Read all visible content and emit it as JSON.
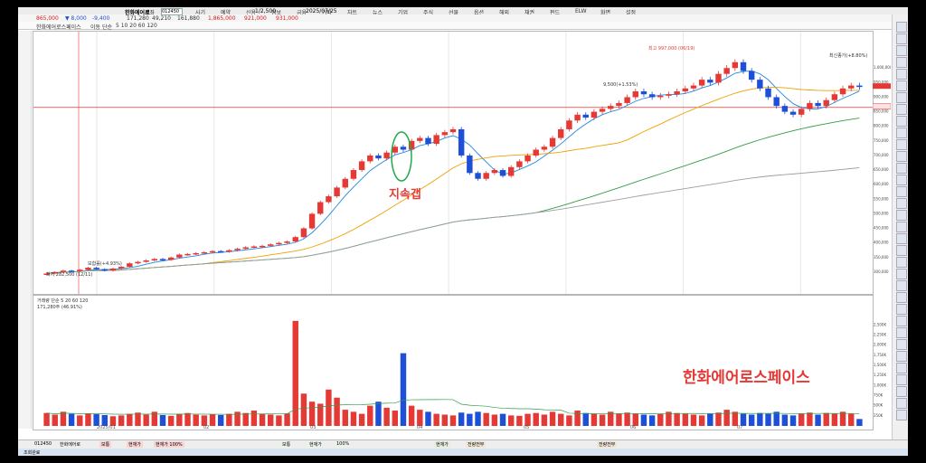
{
  "toolbar": {
    "top_items": [
      "계좌",
      "팔기",
      "사기",
      "예약",
      "신용",
      "정보",
      "금융",
      "기타",
      "차트",
      "뉴스",
      "기업",
      "주식",
      "선물",
      "옵션",
      "해외",
      "채권",
      "펀드",
      "ELW",
      "화면",
      "설정"
    ],
    "stock_code": "012450",
    "stock_name": "한화에어로",
    "row2": {
      "price": "865,000",
      "change": "▼ 8,000",
      "change2": "-9,400",
      "volume_label": "171,280",
      "value": "49,210",
      "info1": "161,880",
      "info2": "1,865,000",
      "info3": "921,000",
      "info4": "931,000",
      "date": "2025/07/25",
      "ratio": "1/2,500"
    },
    "row3": {
      "indicator": "한화에어로스페이스",
      "ma_label": "이동 단순",
      "ma_periods": "5 10 20 60 120"
    }
  },
  "chart_data": [
    {
      "type": "candlestick",
      "title": "",
      "ylabel": "",
      "ylim": [
        250000,
        1100000
      ],
      "x_ticks": [
        "2025/01",
        "02",
        "03",
        "04",
        "05",
        "06",
        "07"
      ],
      "y_ticks": [
        300000,
        350000,
        400000,
        450000,
        500000,
        550000,
        600000,
        650000,
        700000,
        750000,
        800000,
        850000,
        900000,
        950000,
        1000000
      ],
      "y_tick_labels": [
        "300,000",
        "350,000",
        "400,000",
        "450,000",
        "500,000",
        "550,000",
        "600,000",
        "650,000",
        "700,000",
        "750,000",
        "800,000",
        "850,000",
        "900,000",
        "950,000",
        "1,000,000"
      ],
      "horizontal_line": 865000,
      "current_price": 935000,
      "series": [
        {
          "name": "5",
          "color": "#1e88e5"
        },
        {
          "name": "20",
          "color": "#f0a000"
        },
        {
          "name": "60",
          "color": "#2e9e4a"
        },
        {
          "name": "120",
          "color": "#9e9e9e"
        }
      ],
      "close_values": [
        295000,
        300000,
        305000,
        303000,
        308000,
        315000,
        310000,
        305000,
        312000,
        318000,
        330000,
        335000,
        340000,
        345000,
        342000,
        350000,
        360000,
        362000,
        365000,
        368000,
        372000,
        370000,
        375000,
        380000,
        385000,
        388000,
        390000,
        395000,
        400000,
        405000,
        420000,
        450000,
        500000,
        540000,
        560000,
        590000,
        620000,
        650000,
        680000,
        700000,
        690000,
        710000,
        730000,
        720000,
        750000,
        760000,
        740000,
        770000,
        780000,
        790000,
        700000,
        640000,
        620000,
        640000,
        650000,
        630000,
        660000,
        680000,
        700000,
        720000,
        730000,
        760000,
        790000,
        820000,
        840000,
        830000,
        850000,
        860000,
        870000,
        880000,
        900000,
        920000,
        910000,
        900000,
        905000,
        910000,
        920000,
        930000,
        940000,
        960000,
        950000,
        980000,
        1000000,
        1020000,
        990000,
        960000,
        930000,
        900000,
        870000,
        850000,
        840000,
        860000,
        880000,
        870000,
        890000,
        910000,
        930000,
        940000,
        935000
      ],
      "annotations": [
        {
          "text": "최저 282,500 (12/11)"
        },
        {
          "text": "최고 997,000 (06/19)"
        },
        {
          "text": "보합률(+4.93%)"
        },
        {
          "text": "9,500(+1.53%)"
        },
        {
          "text": "최신종가(+8.80%)"
        }
      ],
      "handwritten_label": "지속갭",
      "watermark_title": "한화에어로스페이스"
    },
    {
      "type": "bar",
      "title": "",
      "legend_label": "거래량 단순 5 20 60 120",
      "value_label": "171,280주 (46.91%)",
      "ylim": [
        0,
        3000000
      ],
      "y_ticks": [
        250000,
        500000,
        750000,
        1000000,
        1250000,
        1500000,
        1750000,
        2000000,
        2250000,
        2500000
      ],
      "y_tick_labels": [
        "250K",
        "500K",
        "750K",
        "1,000K",
        "1,250K",
        "1,500K",
        "1,750K",
        "2,000K",
        "2,250K",
        "2,500K"
      ],
      "values": [
        320000,
        280000,
        350000,
        300000,
        260000,
        310000,
        290000,
        270000,
        240000,
        260000,
        300000,
        330000,
        280000,
        350000,
        270000,
        250000,
        300000,
        320000,
        280000,
        260000,
        290000,
        270000,
        300000,
        350000,
        320000,
        380000,
        300000,
        280000,
        260000,
        310000,
        2600000,
        800000,
        600000,
        550000,
        900000,
        700000,
        400000,
        350000,
        300000,
        500000,
        600000,
        450000,
        380000,
        1800000,
        500000,
        400000,
        350000,
        300000,
        280000,
        260000,
        330000,
        300000,
        350000,
        320000,
        280000,
        300000,
        260000,
        250000,
        300000,
        320000,
        280000,
        350000,
        300000,
        260000,
        380000,
        320000,
        300000,
        280000,
        350000,
        300000,
        330000,
        300000,
        280000,
        260000,
        300000,
        350000,
        320000,
        300000,
        280000,
        260000,
        300000,
        330000,
        400000,
        350000,
        300000,
        280000,
        320000,
        300000,
        350000,
        280000,
        260000,
        300000,
        330000,
        280000,
        320000,
        300000,
        350000,
        300000,
        171280
      ]
    }
  ],
  "bottom_bar": {
    "code": "012450",
    "name": "한화에어로",
    "labels": [
      "보통",
      "현재가",
      "현재가 100%",
      "보통",
      "현재가",
      "100%",
      "현재가",
      "전량전부",
      "전량전부"
    ]
  },
  "status_bar": {
    "text": "조회완료"
  }
}
